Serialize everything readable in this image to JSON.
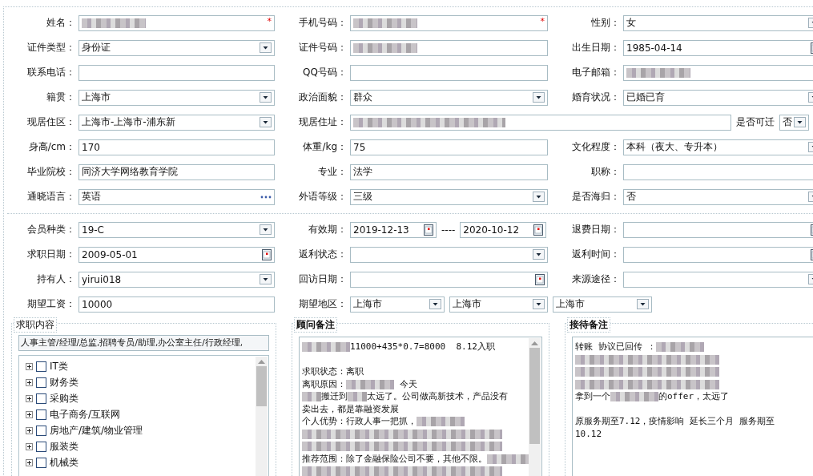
{
  "sections": [
    {
      "rows": [
        [
          {
            "label": "姓名：",
            "fields": [
              {
                "kind": "text",
                "blurred": true,
                "required_mark": "*"
              }
            ]
          },
          {
            "label": "手机号码：",
            "fields": [
              {
                "kind": "text",
                "blurred": true,
                "required_mark": "*"
              }
            ]
          },
          {
            "label": "性别：",
            "fields": [
              {
                "kind": "select",
                "value": "女"
              }
            ]
          }
        ],
        [
          {
            "label": "证件类型：",
            "fields": [
              {
                "kind": "select",
                "value": "身份证"
              }
            ]
          },
          {
            "label": "证件号码：",
            "fields": [
              {
                "kind": "text",
                "blurred": true
              }
            ]
          },
          {
            "label": "出生日期：",
            "fields": [
              {
                "kind": "date",
                "value": "1985-04-14"
              }
            ]
          }
        ],
        [
          {
            "label": "联系电话：",
            "fields": [
              {
                "kind": "text"
              }
            ]
          },
          {
            "label": "QQ号码：",
            "fields": [
              {
                "kind": "text"
              }
            ]
          },
          {
            "label": "电子邮箱：",
            "fields": [
              {
                "kind": "text",
                "blurred": true
              }
            ]
          }
        ],
        [
          {
            "label": "籍贯：",
            "fields": [
              {
                "kind": "select",
                "value": "上海市"
              }
            ]
          },
          {
            "label": "政治面貌：",
            "fields": [
              {
                "kind": "select",
                "value": "群众"
              }
            ]
          },
          {
            "label": "婚育状况：",
            "fields": [
              {
                "kind": "select",
                "value": "已婚已育"
              }
            ]
          }
        ],
        [
          {
            "label": "现居住区：",
            "fields": [
              {
                "kind": "select",
                "value": "上海市-上海市-浦东新"
              }
            ]
          },
          {
            "label": "现居住址：",
            "fields": [
              {
                "kind": "text",
                "blurred": true
              },
              {
                "kind": "label",
                "text": "是否可迁"
              },
              {
                "kind": "select",
                "value": "否"
              }
            ]
          }
        ],
        [
          {
            "label": "身高/cm：",
            "fields": [
              {
                "kind": "text",
                "value": "170"
              }
            ]
          },
          {
            "label": "体重/kg：",
            "fields": [
              {
                "kind": "text",
                "value": "75"
              }
            ]
          },
          {
            "label": "文化程度：",
            "fields": [
              {
                "kind": "select",
                "value": "本科（夜大、专升本）"
              }
            ]
          }
        ],
        [
          {
            "label": "毕业院校：",
            "fields": [
              {
                "kind": "text",
                "value": "同济大学网络教育学院"
              }
            ]
          },
          {
            "label": "专业：",
            "fields": [
              {
                "kind": "text",
                "value": "法学"
              }
            ]
          },
          {
            "label": "职称：",
            "fields": [
              {
                "kind": "text"
              }
            ]
          }
        ],
        [
          {
            "label": "通晓语言：",
            "fields": [
              {
                "kind": "lookup",
                "value": "英语"
              }
            ]
          },
          {
            "label": "外语等级：",
            "fields": [
              {
                "kind": "select",
                "value": "三级"
              }
            ]
          },
          {
            "label": "是否海归：",
            "fields": [
              {
                "kind": "select",
                "value": "否"
              }
            ]
          }
        ]
      ]
    },
    {
      "rows": [
        [
          {
            "label": "会员种类：",
            "fields": [
              {
                "kind": "select",
                "value": "19-C"
              }
            ]
          },
          {
            "label": "有效期：",
            "fields": [
              {
                "kind": "date",
                "value": "2019-12-13"
              },
              {
                "kind": "label",
                "text": "----"
              },
              {
                "kind": "date",
                "value": "2020-10-12"
              }
            ]
          },
          {
            "label": "退费日期：",
            "fields": [
              {
                "kind": "date"
              }
            ]
          }
        ],
        [
          {
            "label": "求职日期：",
            "fields": [
              {
                "kind": "date",
                "value": "2009-05-01"
              }
            ]
          },
          {
            "label": "返利状态：",
            "fields": [
              {
                "kind": "select"
              }
            ]
          },
          {
            "label": "返利时间：",
            "fields": [
              {
                "kind": "date"
              }
            ]
          }
        ],
        [
          {
            "label": "持有人：",
            "fields": [
              {
                "kind": "select",
                "value": "yirui018"
              }
            ]
          },
          {
            "label": "回访日期：",
            "fields": [
              {
                "kind": "date"
              }
            ]
          },
          {
            "label": "来源途径：",
            "fields": [
              {
                "kind": "select"
              }
            ]
          }
        ],
        [
          {
            "label": "期望工资：",
            "fields": [
              {
                "kind": "text",
                "value": "10000"
              }
            ]
          },
          {
            "label": "期望地区：",
            "fields": [
              {
                "kind": "select",
                "value": "上海市"
              },
              {
                "kind": "select",
                "value": "上海市"
              },
              {
                "kind": "select",
                "value": "上海市"
              }
            ]
          }
        ]
      ]
    }
  ],
  "job_content": {
    "title": "求职内容",
    "value": "人事主管/经理/总监,招聘专员/助理,办公室主任/行政经理,",
    "tree": [
      {
        "label": "IT类",
        "expanded": false,
        "checked": false
      },
      {
        "label": "财务类",
        "expanded": false,
        "checked": false
      },
      {
        "label": "采购类",
        "expanded": false,
        "checked": false
      },
      {
        "label": "电子商务/互联网",
        "expanded": false,
        "checked": false
      },
      {
        "label": "房地产/建筑/物业管理",
        "expanded": false,
        "checked": false
      },
      {
        "label": "服装类",
        "expanded": false,
        "checked": false
      },
      {
        "label": "机械类",
        "expanded": false,
        "checked": false
      }
    ]
  },
  "notes": [
    {
      "title": "顾问备注",
      "scrollbar": true,
      "lines": [
        {
          "kind": "line",
          "parts": [
            {
              "kind": "blur"
            },
            {
              "kind": "text",
              "text": "11000+435*0.7=8000  8.12入职"
            }
          ]
        },
        {
          "kind": "blank"
        },
        {
          "kind": "line",
          "parts": [
            {
              "kind": "text",
              "text": "求职状态：离职"
            }
          ]
        },
        {
          "kind": "line",
          "parts": [
            {
              "kind": "text",
              "text": "离职原因："
            },
            {
              "kind": "blur"
            },
            {
              "kind": "text",
              "text": " 今天"
            }
          ]
        },
        {
          "kind": "line",
          "parts": [
            {
              "kind": "blur"
            },
            {
              "kind": "text",
              "text": "搬迁到"
            },
            {
              "kind": "blur"
            },
            {
              "kind": "text",
              "text": "太远了。公司做高新技术，产品没有"
            }
          ]
        },
        {
          "kind": "line",
          "parts": [
            {
              "kind": "text",
              "text": "卖出去，都是靠融资发展"
            }
          ]
        },
        {
          "kind": "line",
          "parts": [
            {
              "kind": "text",
              "text": "个人优势：行政人事一把抓，"
            },
            {
              "kind": "blur"
            }
          ]
        },
        {
          "kind": "line",
          "parts": [
            {
              "kind": "blur"
            }
          ]
        },
        {
          "kind": "line",
          "parts": [
            {
              "kind": "blur"
            }
          ]
        },
        {
          "kind": "line",
          "parts": [
            {
              "kind": "text",
              "text": "推荐范围：除了金融保险公司不要，其他不限。"
            },
            {
              "kind": "blur"
            }
          ]
        },
        {
          "kind": "line",
          "parts": [
            {
              "kind": "blur"
            }
          ]
        }
      ]
    },
    {
      "title": "接待备注",
      "scrollbar": false,
      "lines": [
        {
          "kind": "line",
          "parts": [
            {
              "kind": "text",
              "text": "转账 协议已回传 ："
            },
            {
              "kind": "blur"
            }
          ]
        },
        {
          "kind": "line",
          "parts": [
            {
              "kind": "blur"
            }
          ]
        },
        {
          "kind": "line",
          "parts": [
            {
              "kind": "blur"
            }
          ]
        },
        {
          "kind": "line",
          "parts": [
            {
              "kind": "blur"
            }
          ]
        },
        {
          "kind": "line",
          "parts": [
            {
              "kind": "text",
              "text": "拿到一个"
            },
            {
              "kind": "blur"
            },
            {
              "kind": "text",
              "text": "的offer，太远了"
            }
          ]
        },
        {
          "kind": "blank"
        },
        {
          "kind": "line",
          "parts": [
            {
              "kind": "text",
              "text": "原服务期至7.12，疫情影响 延长三个月 服务期至"
            }
          ]
        },
        {
          "kind": "line",
          "parts": [
            {
              "kind": "text",
              "text": "10.12"
            }
          ]
        }
      ]
    }
  ]
}
